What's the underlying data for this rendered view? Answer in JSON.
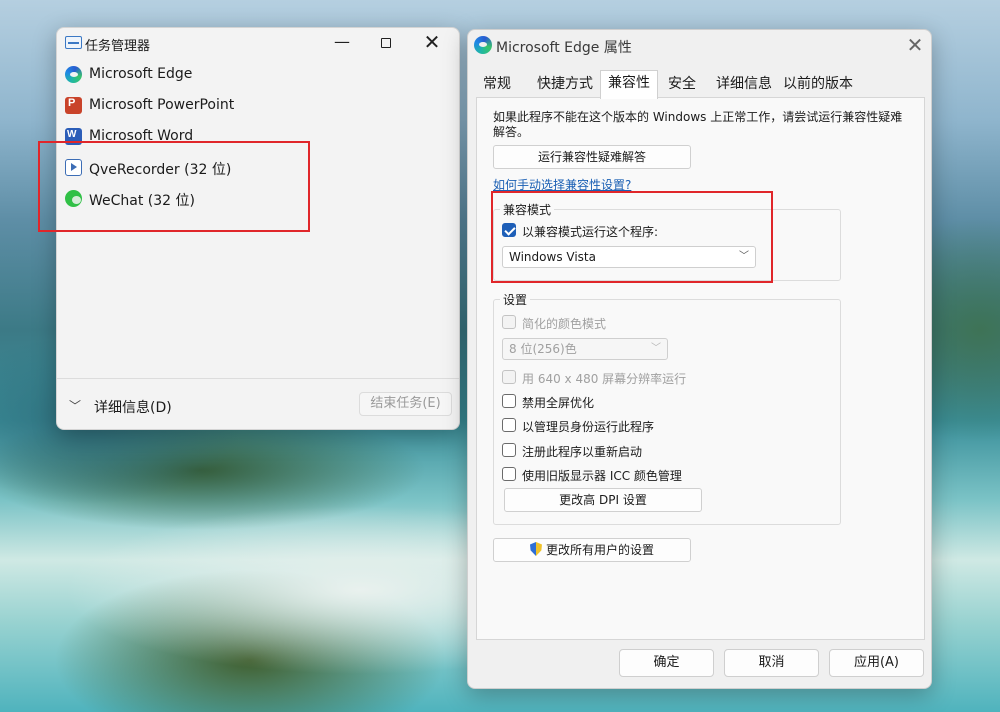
{
  "task_manager": {
    "title": "任务管理器",
    "apps": [
      {
        "name": "Microsoft Edge",
        "icon": "edge-icon"
      },
      {
        "name": "Microsoft PowerPoint",
        "icon": "powerpoint-icon"
      },
      {
        "name": "Microsoft Word",
        "icon": "word-icon"
      },
      {
        "name": "QveRecorder (32 位)",
        "icon": "qverecorder-icon"
      },
      {
        "name": "WeChat (32 位)",
        "icon": "wechat-icon"
      }
    ],
    "details_label": "详细信息(D)",
    "end_task_label": "结束任务(E)",
    "window_controls": {
      "minimize": "—",
      "close": "✕"
    }
  },
  "properties": {
    "title": "Microsoft Edge 属性",
    "close_glyph": "✕",
    "tabs": [
      "常规",
      "快捷方式",
      "兼容性",
      "安全",
      "详细信息",
      "以前的版本"
    ],
    "active_tab": "兼容性",
    "description": "如果此程序不能在这个版本的 Windows 上正常工作，请尝试运行兼容性疑难解答。",
    "troubleshoot_button": "运行兼容性疑难解答",
    "help_link": "如何手动选择兼容性设置?",
    "compat_group": {
      "title": "兼容模式",
      "checkbox_label": "以兼容模式运行这个程序:",
      "checked": true,
      "selected_os": "Windows Vista"
    },
    "settings_group": {
      "title": "设置",
      "reduced_color_label": "简化的颜色模式",
      "color_depth_value": "8 位(256)色",
      "resolution_label": "用 640 x 480 屏幕分辨率运行",
      "fullscreen_label": "禁用全屏优化",
      "admin_label": "以管理员身份运行此程序",
      "restart_label": "注册此程序以重新启动",
      "icc_label": "使用旧版显示器 ICC 颜色管理",
      "dpi_button": "更改高 DPI 设置"
    },
    "change_all_users_button": "更改所有用户的设置",
    "ok_button": "确定",
    "cancel_button": "取消",
    "apply_button": "应用(A)"
  },
  "colors": {
    "highlight": "#e0262a",
    "accent": "#1e5fb8",
    "link": "#1a5fb4"
  }
}
